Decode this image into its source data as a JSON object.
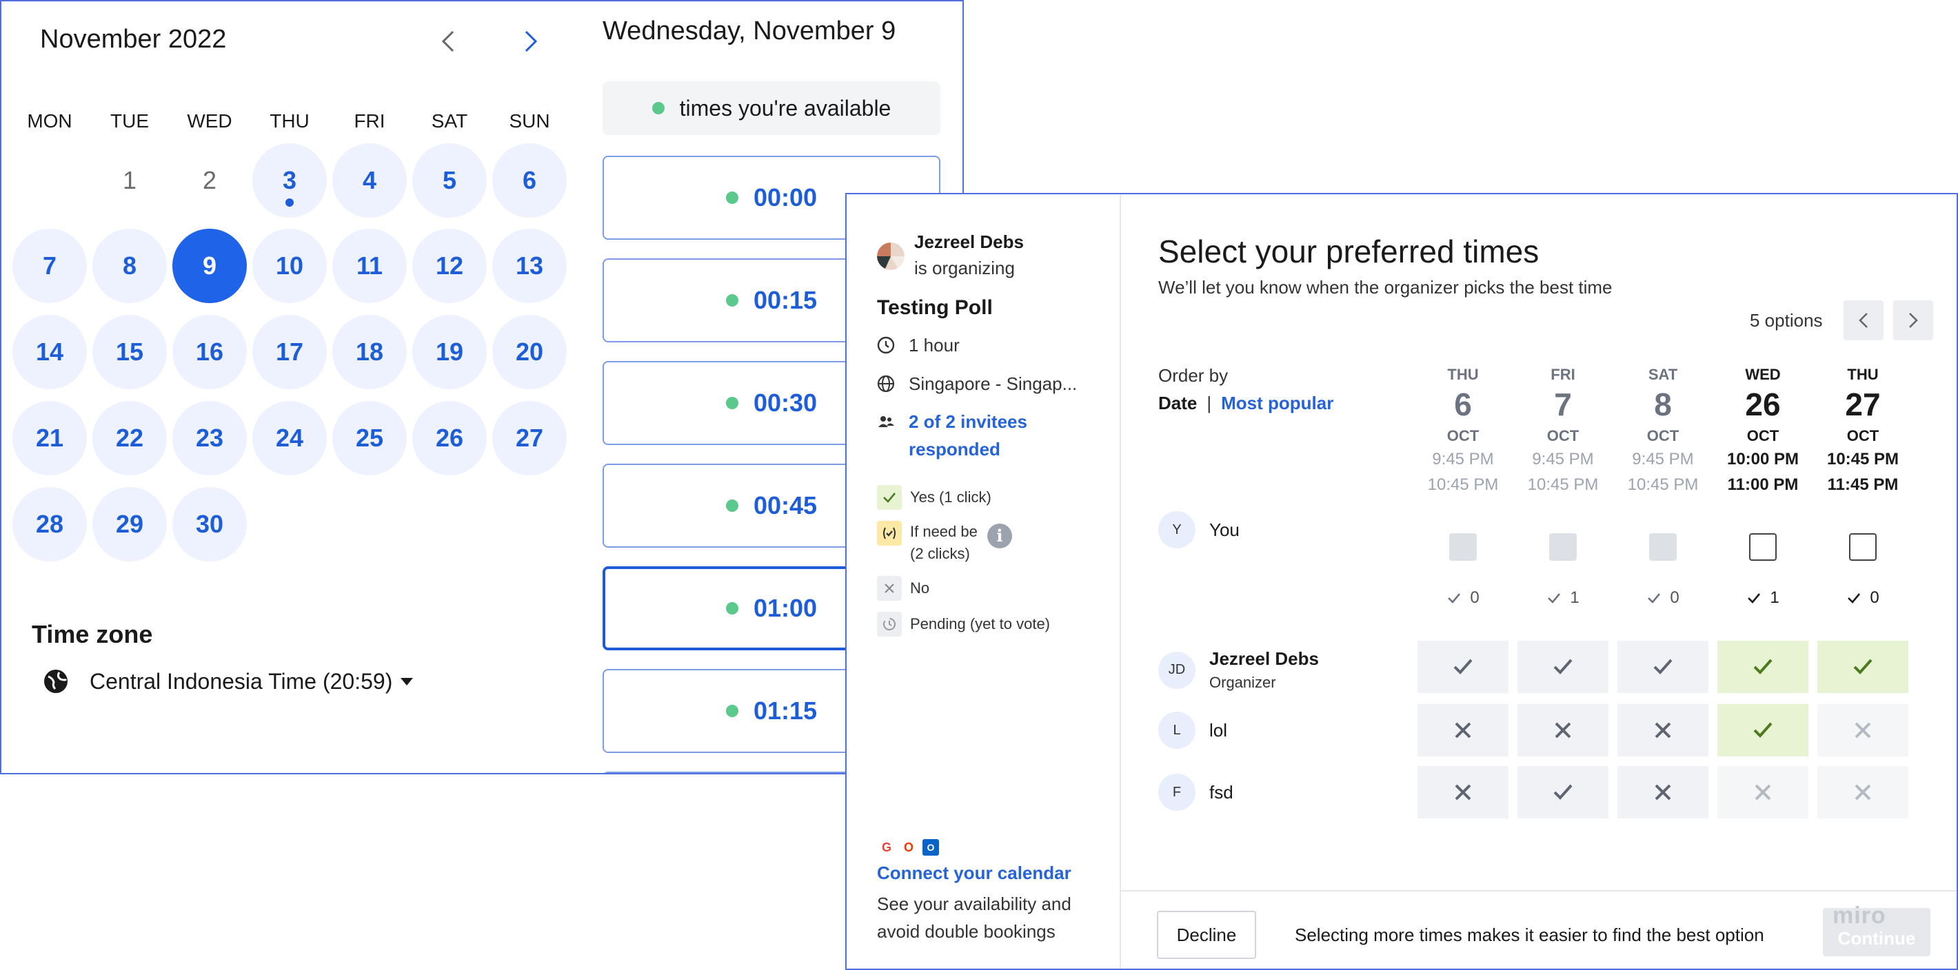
{
  "calendar": {
    "month_title": "November 2022",
    "weekdays": [
      "MON",
      "TUE",
      "WED",
      "THU",
      "FRI",
      "SAT",
      "SUN"
    ],
    "days": [
      {
        "label": "1",
        "state": "disabled"
      },
      {
        "label": "2",
        "state": "disabled"
      },
      {
        "label": "3",
        "state": "available",
        "today": true
      },
      {
        "label": "4",
        "state": "available"
      },
      {
        "label": "5",
        "state": "available"
      },
      {
        "label": "6",
        "state": "available"
      },
      {
        "label": "7",
        "state": "available"
      },
      {
        "label": "8",
        "state": "available"
      },
      {
        "label": "9",
        "state": "selected"
      },
      {
        "label": "10",
        "state": "available"
      },
      {
        "label": "11",
        "state": "available"
      },
      {
        "label": "12",
        "state": "available"
      },
      {
        "label": "13",
        "state": "available"
      },
      {
        "label": "14",
        "state": "available"
      },
      {
        "label": "15",
        "state": "available"
      },
      {
        "label": "16",
        "state": "available"
      },
      {
        "label": "17",
        "state": "available"
      },
      {
        "label": "18",
        "state": "available"
      },
      {
        "label": "19",
        "state": "available"
      },
      {
        "label": "20",
        "state": "available"
      },
      {
        "label": "21",
        "state": "available"
      },
      {
        "label": "22",
        "state": "available"
      },
      {
        "label": "23",
        "state": "available"
      },
      {
        "label": "24",
        "state": "available"
      },
      {
        "label": "25",
        "state": "available"
      },
      {
        "label": "26",
        "state": "available"
      },
      {
        "label": "27",
        "state": "available"
      },
      {
        "label": "28",
        "state": "available"
      },
      {
        "label": "29",
        "state": "available"
      },
      {
        "label": "30",
        "state": "available"
      }
    ],
    "timezone_title": "Time zone",
    "timezone_value": "Central Indonesia Time (20:59)",
    "selected_date": "Wednesday, November 9",
    "availability_label": "times you're available",
    "slots": [
      "00:00",
      "00:15",
      "00:30",
      "00:45",
      "01:00",
      "01:15"
    ],
    "active_slot": "01:00"
  },
  "poll": {
    "organizer_name": "Jezreel Debs",
    "organizer_sub": "is organizing",
    "title": "Testing Poll",
    "duration": "1 hour",
    "timezone": "Singapore - Singap...",
    "invitees_line1": "2 of 2 invitees",
    "invitees_line2": "responded",
    "legend": {
      "yes": "Yes (1 click)",
      "ifneed_line1": "If need be",
      "ifneed_line2": "(2 clicks)",
      "no": "No",
      "pending": "Pending (yet to vote)"
    },
    "connect_title": "Connect your calendar",
    "connect_sub": "See your availability and avoid double bookings",
    "main_title": "Select your preferred times",
    "main_sub": "We’ll let you know when the organizer picks the best time",
    "options_count": "5 options",
    "order_label": "Order by",
    "order_date": "Date",
    "order_sep": "|",
    "order_popular": "Most popular",
    "columns": [
      {
        "dow": "THU",
        "day": "6",
        "month": "OCT",
        "start": "9:45 PM",
        "end": "10:45 PM",
        "strong": false
      },
      {
        "dow": "FRI",
        "day": "7",
        "month": "OCT",
        "start": "9:45 PM",
        "end": "10:45 PM",
        "strong": false
      },
      {
        "dow": "SAT",
        "day": "8",
        "month": "OCT",
        "start": "9:45 PM",
        "end": "10:45 PM",
        "strong": false
      },
      {
        "dow": "WED",
        "day": "26",
        "month": "OCT",
        "start": "10:00 PM",
        "end": "11:00 PM",
        "strong": true
      },
      {
        "dow": "THU",
        "day": "27",
        "month": "OCT",
        "start": "10:45 PM",
        "end": "11:45 PM",
        "strong": true
      }
    ],
    "you": {
      "initial": "Y",
      "name": "You",
      "checkboxes": [
        "filled",
        "filled",
        "filled",
        "empty",
        "empty"
      ]
    },
    "tallies": [
      "0",
      "1",
      "0",
      "1",
      "0"
    ],
    "participants": [
      {
        "initials": "JD",
        "name": "Jezreel Debs",
        "role": "Organizer",
        "votes": [
          "yes",
          "yes",
          "yes",
          "yes-hi",
          "yes-hi"
        ]
      },
      {
        "initials": "L",
        "name": "lol",
        "role": "",
        "votes": [
          "no",
          "no",
          "no",
          "yes-hi",
          "no-light"
        ]
      },
      {
        "initials": "F",
        "name": "fsd",
        "role": "",
        "votes": [
          "no",
          "yes",
          "no",
          "no-light",
          "no-light"
        ]
      }
    ],
    "decline_label": "Decline",
    "footer_message": "Selecting more times makes it easier to find the best option",
    "continue_label": "Continue",
    "watermark": "miro"
  },
  "colors": {
    "accent": "#1f63e8",
    "day_bg": "#edf2fe",
    "available_dot": "#5bc98b",
    "yes_highlight": "#e8f3d4",
    "yes_check": "#4b7a1f"
  }
}
